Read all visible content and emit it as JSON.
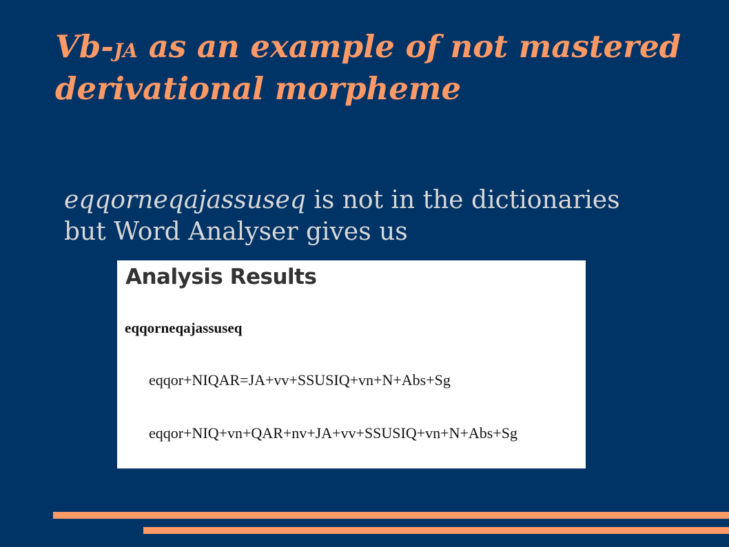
{
  "title": {
    "prefix": "Vb-",
    "smallcaps": "JA",
    "rest": " as an example of not mastered derivational morpheme"
  },
  "body": {
    "word": "eqqorneqajassuseq",
    "line1_rest": " is not in the dictionaries",
    "line2": "but Word Analyser gives us"
  },
  "results": {
    "heading": "Analysis Results",
    "word": "eqqorneqajassuseq",
    "analyses": [
      "eqqor+NIQAR=JA+vv+SSUSIQ+vn+N+Abs+Sg",
      "eqqor+NIQ+vn+QAR+nv+JA+vv+SSUSIQ+vn+N+Abs+Sg"
    ]
  },
  "colors": {
    "background": "#003366",
    "accent": "#ff9966",
    "body_text": "#d9d9d9"
  }
}
